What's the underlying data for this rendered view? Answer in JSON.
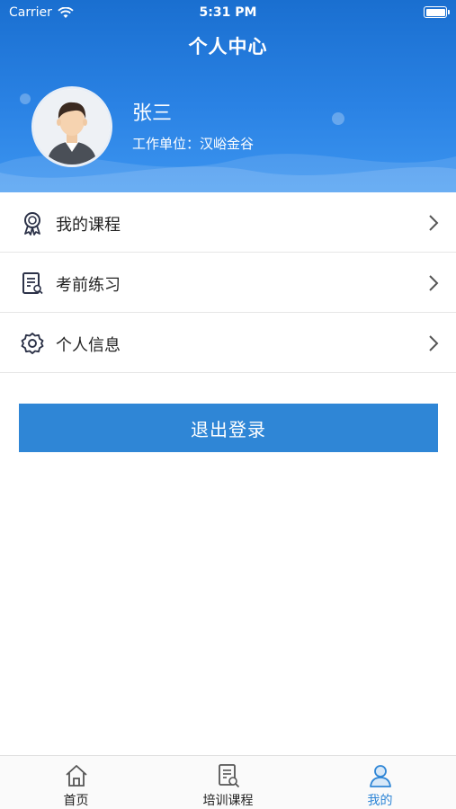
{
  "status_bar": {
    "carrier": "Carrier",
    "time": "5:31 PM"
  },
  "header": {
    "title": "个人中心"
  },
  "profile": {
    "name": "张三",
    "work_unit_label": "工作单位：",
    "work_unit_value": "汉峪金谷"
  },
  "menu": [
    {
      "label": "我的课程",
      "icon": "award-icon"
    },
    {
      "label": "考前练习",
      "icon": "exam-practice-icon"
    },
    {
      "label": "个人信息",
      "icon": "gear-icon"
    }
  ],
  "logout_label": "退出登录",
  "tabs": [
    {
      "label": "首页",
      "icon": "home-icon"
    },
    {
      "label": "培训课程",
      "icon": "course-search-icon"
    },
    {
      "label": "我的",
      "icon": "user-icon",
      "active": true
    }
  ],
  "colors": {
    "accent": "#2f86d6",
    "header_top": "#1a6fd0",
    "header_bottom": "#3c95f0"
  }
}
